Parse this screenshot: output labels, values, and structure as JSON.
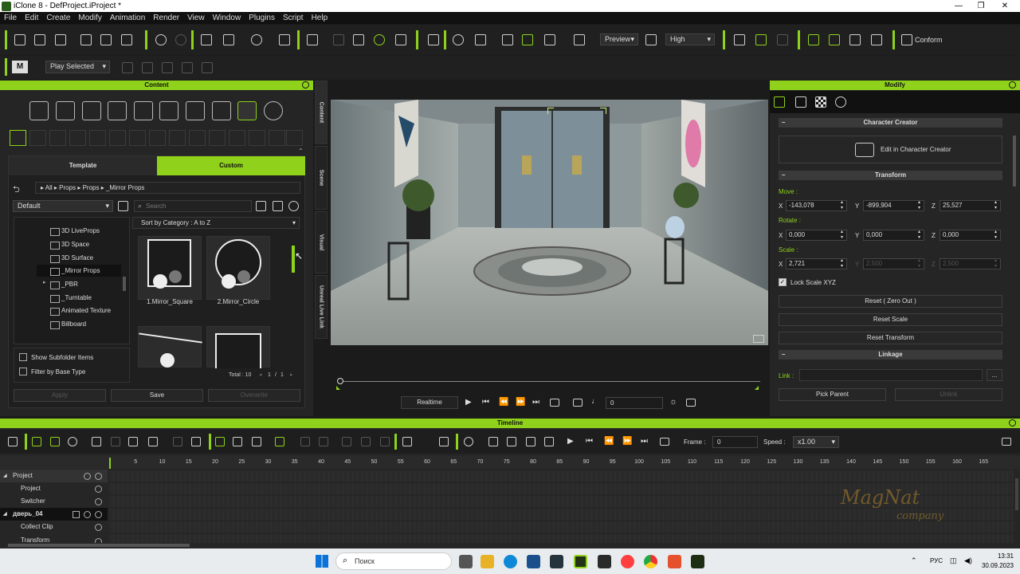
{
  "window": {
    "title": "iClone 8 - DefProject.iProject *",
    "controls": [
      "minimize-icon",
      "maximize-icon",
      "close-icon"
    ]
  },
  "menu": [
    "File",
    "Edit",
    "Create",
    "Modify",
    "Animation",
    "Render",
    "View",
    "Window",
    "Plugins",
    "Script",
    "Help"
  ],
  "toolbar": {
    "preview_label": "Preview",
    "quality_label": "High",
    "conform_label": "Conform",
    "play_mode": "Play Selected"
  },
  "content": {
    "title": "Content",
    "tabs": {
      "template": "Template",
      "custom": "Custom"
    },
    "breadcrumb": [
      "All",
      "Props",
      "Props",
      "_Mirror Props"
    ],
    "filter": "Default",
    "search_placeholder": "Search",
    "sort": "Sort by Category : A to Z",
    "tree": [
      "3D LiveProps",
      "3D Space",
      "3D Surface",
      "_Mirror Props",
      "_PBR",
      "_Turntable",
      "Animated Texture",
      "Billboard"
    ],
    "selected_tree": "_Mirror Props",
    "items": [
      "1.Mirror_Square",
      "2.Mirror_Circle"
    ],
    "total": "Total : 10",
    "page": "1",
    "pages": "1",
    "show_subfolder": "Show Subfolder Items",
    "filter_base": "Filter by Base Type",
    "apply": "Apply",
    "save": "Save",
    "overwrite": "Overwrite",
    "side_tabs": [
      "Content",
      "Scene",
      "Visual",
      "Unreal Live Link"
    ]
  },
  "player": {
    "mode": "Realtime",
    "frame": "0"
  },
  "modify": {
    "title": "Modify",
    "character_creator": "Character Creator",
    "edit_cc": "Edit in Character Creator",
    "transform": "Transform",
    "move_label": "Move :",
    "rotate_label": "Rotate :",
    "scale_label": "Scale :",
    "move": {
      "x": "-143,078",
      "y": "-899,904",
      "z": "25,527"
    },
    "rotate": {
      "x": "0,000",
      "y": "0,000",
      "z": "0,000"
    },
    "scale": {
      "x": "2,721",
      "y": "2,500",
      "z": "2,500"
    },
    "axes": {
      "x": "X",
      "y": "Y",
      "z": "Z"
    },
    "lock_scale": "Lock Scale XYZ",
    "reset_zero": "Reset ( Zero Out )",
    "reset_scale": "Reset Scale",
    "reset_transform": "Reset Transform",
    "linkage": "Linkage",
    "link_label": "Link :",
    "link_more": "...",
    "pick_parent": "Pick Parent",
    "unlink": "Unlink"
  },
  "timeline": {
    "title": "Timeline",
    "frame_label": "Frame :",
    "frame": "0",
    "speed_label": "Speed :",
    "speed": "x1.00",
    "ticks": [
      "5",
      "10",
      "15",
      "20",
      "25",
      "30",
      "35",
      "40",
      "45",
      "50",
      "55",
      "60",
      "65",
      "70",
      "75",
      "80",
      "85",
      "90",
      "95",
      "100",
      "105",
      "110",
      "115",
      "120",
      "125",
      "130",
      "135",
      "140",
      "145",
      "150",
      "155",
      "160",
      "165"
    ],
    "rows": [
      {
        "label": "Project",
        "level": 0
      },
      {
        "label": "Project",
        "level": 1
      },
      {
        "label": "Switcher",
        "level": 1
      },
      {
        "label": "дверь_04",
        "level": 0
      },
      {
        "label": "Collect Clip",
        "level": 1
      },
      {
        "label": "Transform",
        "level": 1
      }
    ],
    "watermark_line1": "MagNat",
    "watermark_line2": "company"
  },
  "taskbar": {
    "search": "Поиск",
    "lang": "РУС",
    "time": "13:31",
    "date": "30.09.2023"
  },
  "colors": {
    "accent": "#8fd11b",
    "panel": "#252525",
    "bg": "#1b1b1b"
  }
}
